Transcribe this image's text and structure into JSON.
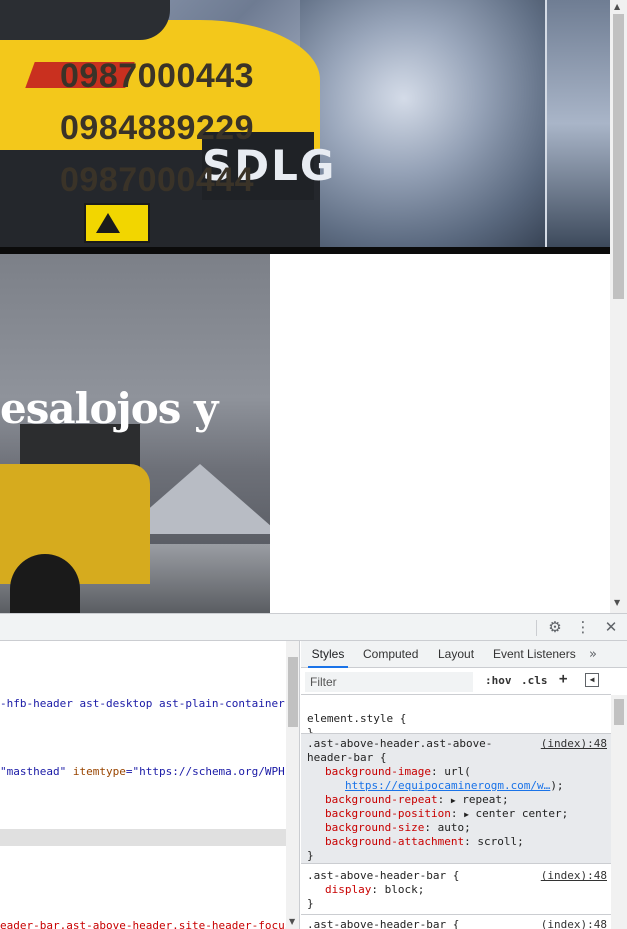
{
  "hero": {
    "phones": [
      "0987000443",
      "0984889229",
      "0987000444"
    ],
    "brand": "SDLG"
  },
  "slide": {
    "heading": "esalojos y"
  },
  "devtools": {
    "elements": {
      "line1": {
        "text": "-hfb-header ast-desktop ast-plain-container"
      },
      "line2": {
        "value": "\"masthead\"",
        "attr": "itemtype",
        "eq": "=",
        "value2": "\"https://schema.org/WPH"
      },
      "bottom": "eader-bar.ast-above-header.site-header-focus-item"
    },
    "tabs": {
      "styles": "Styles",
      "computed": "Computed",
      "layout": "Layout",
      "event_listeners": "Event Listeners",
      "more": "»"
    },
    "filter": {
      "placeholder": "Filter",
      "hov": ":hov",
      "cls": ".cls",
      "plus": "+"
    },
    "rules": {
      "r1": {
        "selector": "element.style {",
        "close": "}"
      },
      "r2": {
        "selector1": ".ast-above-header.ast-above-",
        "selector2": "header-bar {",
        "source": "(index):48",
        "p1": "background-image",
        "v1": "url(",
        "url": "https://equipocaminerogm.com/w…",
        "v1end": ");",
        "p2": "background-repeat",
        "v2": "repeat;",
        "p3": "background-position",
        "v3": "center center;",
        "p4": "background-size",
        "v4": "auto;",
        "p5": "background-attachment",
        "v5": "scroll;",
        "close": "}"
      },
      "r3": {
        "selector": ".ast-above-header-bar {",
        "source": "(index):48",
        "p1": "display",
        "v1": "block;",
        "close": "}"
      },
      "r4": {
        "selector": ".ast-above-header-bar {",
        "source": "(index):48"
      }
    }
  }
}
